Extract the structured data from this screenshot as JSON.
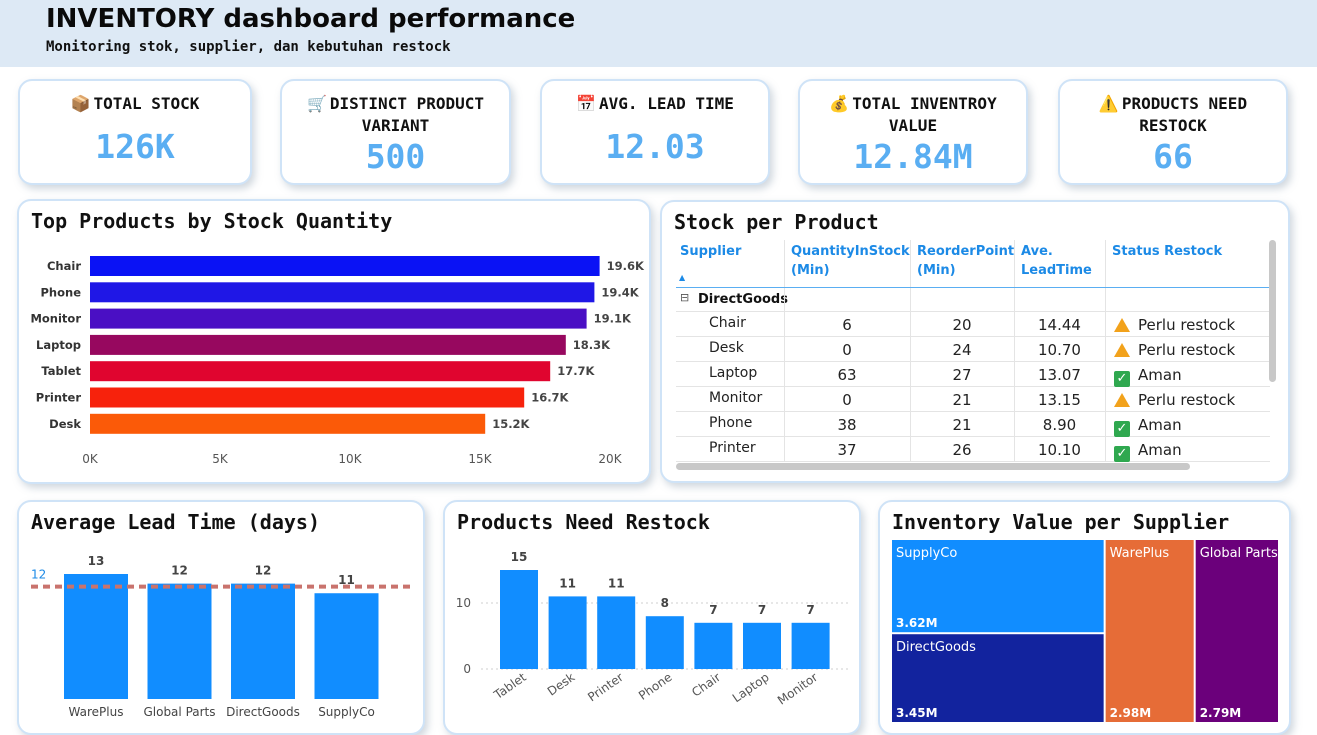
{
  "header": {
    "title": "INVENTORY dashboard performance",
    "subtitle": "Monitoring stok, supplier, dan kebutuhan restock"
  },
  "kpis": [
    {
      "icon": "package-icon",
      "glyph": "📦",
      "label": "TOTAL STOCK",
      "value": "126K"
    },
    {
      "icon": "cart-icon",
      "glyph": "🛒",
      "label": "DISTINCT PRODUCT VARIANT",
      "value": "500"
    },
    {
      "icon": "calendar-icon",
      "glyph": "📅",
      "label": "AVG. LEAD TIME",
      "value": "12.03"
    },
    {
      "icon": "money-bag-icon",
      "glyph": "💰",
      "label": "TOTAL INVENTROY VALUE",
      "value": "12.84M"
    },
    {
      "icon": "warning-icon",
      "glyph": "⚠️",
      "label": "PRODUCTS NEED RESTOCK",
      "value": "66"
    }
  ],
  "colors": {
    "accent": "#5aaef2",
    "bar_blue": "#118dff",
    "header_bg": "#dde9f5",
    "avg_line": "#c9736d"
  },
  "chart_data": [
    {
      "id": "top-products",
      "type": "bar",
      "orientation": "horizontal",
      "title": "Top Products by Stock Quantity",
      "categories": [
        "Chair",
        "Phone",
        "Monitor",
        "Laptop",
        "Tablet",
        "Printer",
        "Desk"
      ],
      "values": [
        19600,
        19400,
        19100,
        18300,
        17700,
        16700,
        15200
      ],
      "labels": [
        "19.6K",
        "19.4K",
        "19.1K",
        "18.3K",
        "17.7K",
        "16.7K",
        "15.2K"
      ],
      "colors": [
        "#0a12f5",
        "#1f17e6",
        "#4a0fc4",
        "#97085f",
        "#e0052f",
        "#f7220c",
        "#fb5a08"
      ],
      "xticks": [
        "0K",
        "5K",
        "10K",
        "15K",
        "20K"
      ],
      "xlim": [
        0,
        20000
      ]
    },
    {
      "id": "avg-lead-time",
      "type": "bar",
      "title": "Average Lead Time (days)",
      "categories": [
        "WarePlus",
        "Global Parts",
        "DirectGoods",
        "SupplyCo"
      ],
      "values": [
        13,
        12,
        12,
        11
      ],
      "labels": [
        "13",
        "12",
        "12",
        "11"
      ],
      "average_line": {
        "value": 12,
        "label": "12"
      },
      "ylim": [
        0,
        13.8
      ]
    },
    {
      "id": "need-restock",
      "type": "bar",
      "title": "Products Need Restock",
      "categories": [
        "Tablet",
        "Desk",
        "Printer",
        "Phone",
        "Chair",
        "Laptop",
        "Monitor"
      ],
      "values": [
        15,
        11,
        11,
        8,
        7,
        7,
        7
      ],
      "labels": [
        "15",
        "11",
        "11",
        "8",
        "7",
        "7",
        "7"
      ],
      "yticks": [
        "0",
        "10"
      ],
      "ylim": [
        0,
        16.5
      ],
      "grid": true
    },
    {
      "id": "inventory-value",
      "type": "treemap",
      "title": "Inventory Value per Supplier",
      "items": [
        {
          "name": "SupplyCo",
          "value": 3.62,
          "label": "3.62M",
          "color": "#118dff"
        },
        {
          "name": "DirectGoods",
          "value": 3.45,
          "label": "3.45M",
          "color": "#12239e"
        },
        {
          "name": "WarePlus",
          "value": 2.98,
          "label": "2.98M",
          "color": "#e66c37"
        },
        {
          "name": "Global Parts",
          "value": 2.79,
          "label": "2.79M",
          "color": "#6b007b"
        }
      ]
    }
  ],
  "stock_table": {
    "title": "Stock per Product",
    "columns": [
      "Supplier",
      "QuantityInStock (Min)",
      "ReorderPoint (Min)",
      "Ave. LeadTime",
      "Status Restock"
    ],
    "column_lines": [
      [
        "Supplier"
      ],
      [
        "QuantityInStock",
        "(Min)"
      ],
      [
        "ReorderPoint",
        "(Min)"
      ],
      [
        "Ave.",
        "LeadTime"
      ],
      [
        "Status Restock"
      ]
    ],
    "sort_indicator": "▲",
    "group": {
      "toggle": "⊟",
      "name": "DirectGoods"
    },
    "rows": [
      {
        "product": "Chair",
        "qty": "6",
        "reorder": "20",
        "lead": "14.44",
        "status": "Perlu restock",
        "status_icon": "warning-icon"
      },
      {
        "product": "Desk",
        "qty": "0",
        "reorder": "24",
        "lead": "10.70",
        "status": "Perlu restock",
        "status_icon": "warning-icon"
      },
      {
        "product": "Laptop",
        "qty": "63",
        "reorder": "27",
        "lead": "13.07",
        "status": "Aman",
        "status_icon": "check-icon"
      },
      {
        "product": "Monitor",
        "qty": "0",
        "reorder": "21",
        "lead": "13.15",
        "status": "Perlu restock",
        "status_icon": "warning-icon"
      },
      {
        "product": "Phone",
        "qty": "38",
        "reorder": "21",
        "lead": "8.90",
        "status": "Aman",
        "status_icon": "check-icon"
      },
      {
        "product": "Printer",
        "qty": "37",
        "reorder": "26",
        "lead": "10.10",
        "status": "Aman",
        "status_icon": "check-icon"
      }
    ]
  }
}
